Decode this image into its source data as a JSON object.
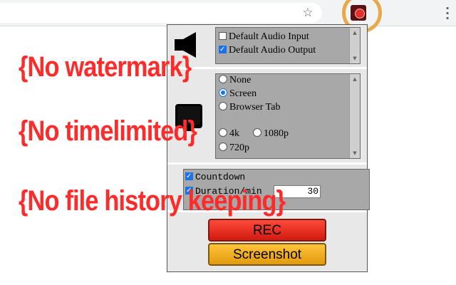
{
  "browser": {
    "bookmark_icon": "star-icon",
    "extension_icon": "screen-recorder-icon",
    "menu_icon": "kebab-menu-icon",
    "highlight_color": "#e9a84a"
  },
  "popup": {
    "audio": {
      "icon": "speaker-icon",
      "options": [
        {
          "label": "Default Audio Input",
          "checked": false
        },
        {
          "label": "Default Audio Output",
          "checked": true
        }
      ]
    },
    "video": {
      "icon": "screen-icon",
      "sources": [
        {
          "label": "None",
          "selected": false
        },
        {
          "label": "Screen",
          "selected": true
        },
        {
          "label": "Browser Tab",
          "selected": false
        }
      ],
      "resolutions": [
        {
          "label": "4k",
          "selected": false
        },
        {
          "label": "1080p",
          "selected": false
        },
        {
          "label": "720p",
          "selected": false
        }
      ]
    },
    "countdown": {
      "label": "Countdown",
      "checked": true
    },
    "duration": {
      "label": "Duration/min",
      "checked": true,
      "value": "30"
    },
    "rec_label": "REC",
    "screenshot_label": "Screenshot",
    "colors": {
      "rec": "#ff3a2a",
      "screenshot": "#f5b01e"
    }
  },
  "captions": [
    "{No watermark}",
    "{No timelimited}",
    "{No file history keeping}"
  ],
  "caption_color": "#ff2b2b"
}
